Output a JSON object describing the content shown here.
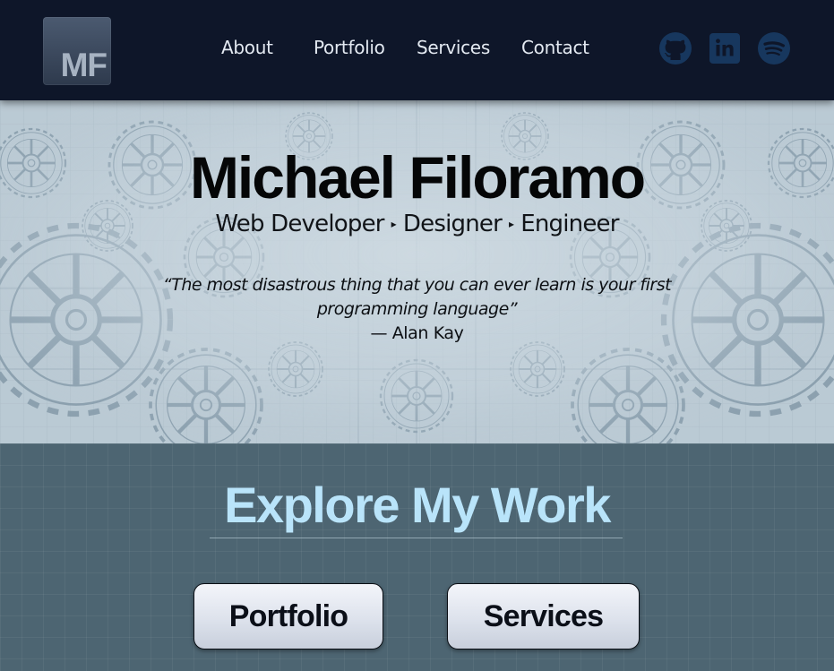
{
  "header": {
    "logo_text": "MF",
    "nav": [
      {
        "label": "About"
      },
      {
        "label": "Portfolio"
      },
      {
        "label": "Services"
      },
      {
        "label": "Contact"
      }
    ],
    "social_icons": [
      "github-icon",
      "linkedin-icon",
      "spotify-icon"
    ]
  },
  "hero": {
    "name": "Michael Filoramo",
    "roles": [
      "Web Developer",
      "Designer",
      "Engineer"
    ],
    "role_separator": "▸",
    "quote": "“The most disastrous thing that you can ever learn is your first programming language”",
    "author": "— Alan Kay"
  },
  "explore": {
    "title": "Explore My Work",
    "buttons": [
      {
        "label": "Portfolio"
      },
      {
        "label": "Services"
      }
    ]
  },
  "colors": {
    "header_bg": "#0e1629",
    "nav_text": "#e3e9f1",
    "social_icon": "#17375e",
    "hero_bg": "#c4d2db",
    "section_bg": "#4d6572",
    "explore_title": "#b9e4fa",
    "button_bg": "#e6eaf2"
  }
}
